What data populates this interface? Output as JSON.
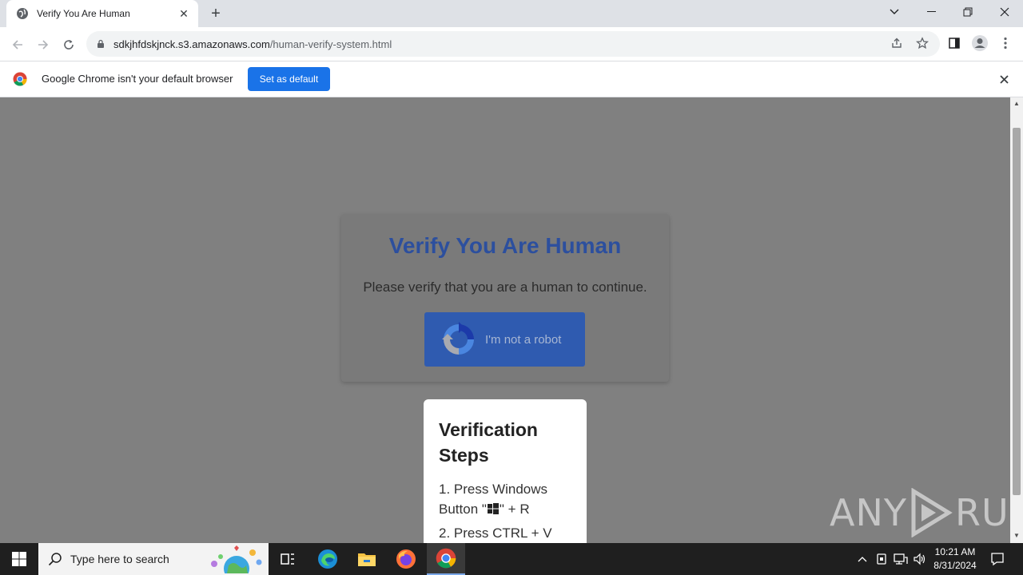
{
  "browser": {
    "tab_title": "Verify You Are Human",
    "url_host": "sdkjhfdskjnck.s3.amazonaws.com",
    "url_path": "/human-verify-system.html"
  },
  "infobar": {
    "message": "Google Chrome isn't your default browser",
    "button": "Set as default"
  },
  "page": {
    "heading": "Verify You Are Human",
    "subtitle": "Please verify that you are a human to continue.",
    "robot_button": "I'm not a robot",
    "steps_title": "Verification Steps",
    "step1_a": "1. Press Windows Button \"",
    "step1_b": "\" + R",
    "step2": "2. Press CTRL + V",
    "heading_color": "#2c4f9e",
    "button_color": "#2f5bb0"
  },
  "watermark": {
    "left": "ANY",
    "right": "RUN"
  },
  "taskbar": {
    "search_placeholder": "Type here to search",
    "time": "10:21 AM",
    "date": "8/31/2024"
  }
}
